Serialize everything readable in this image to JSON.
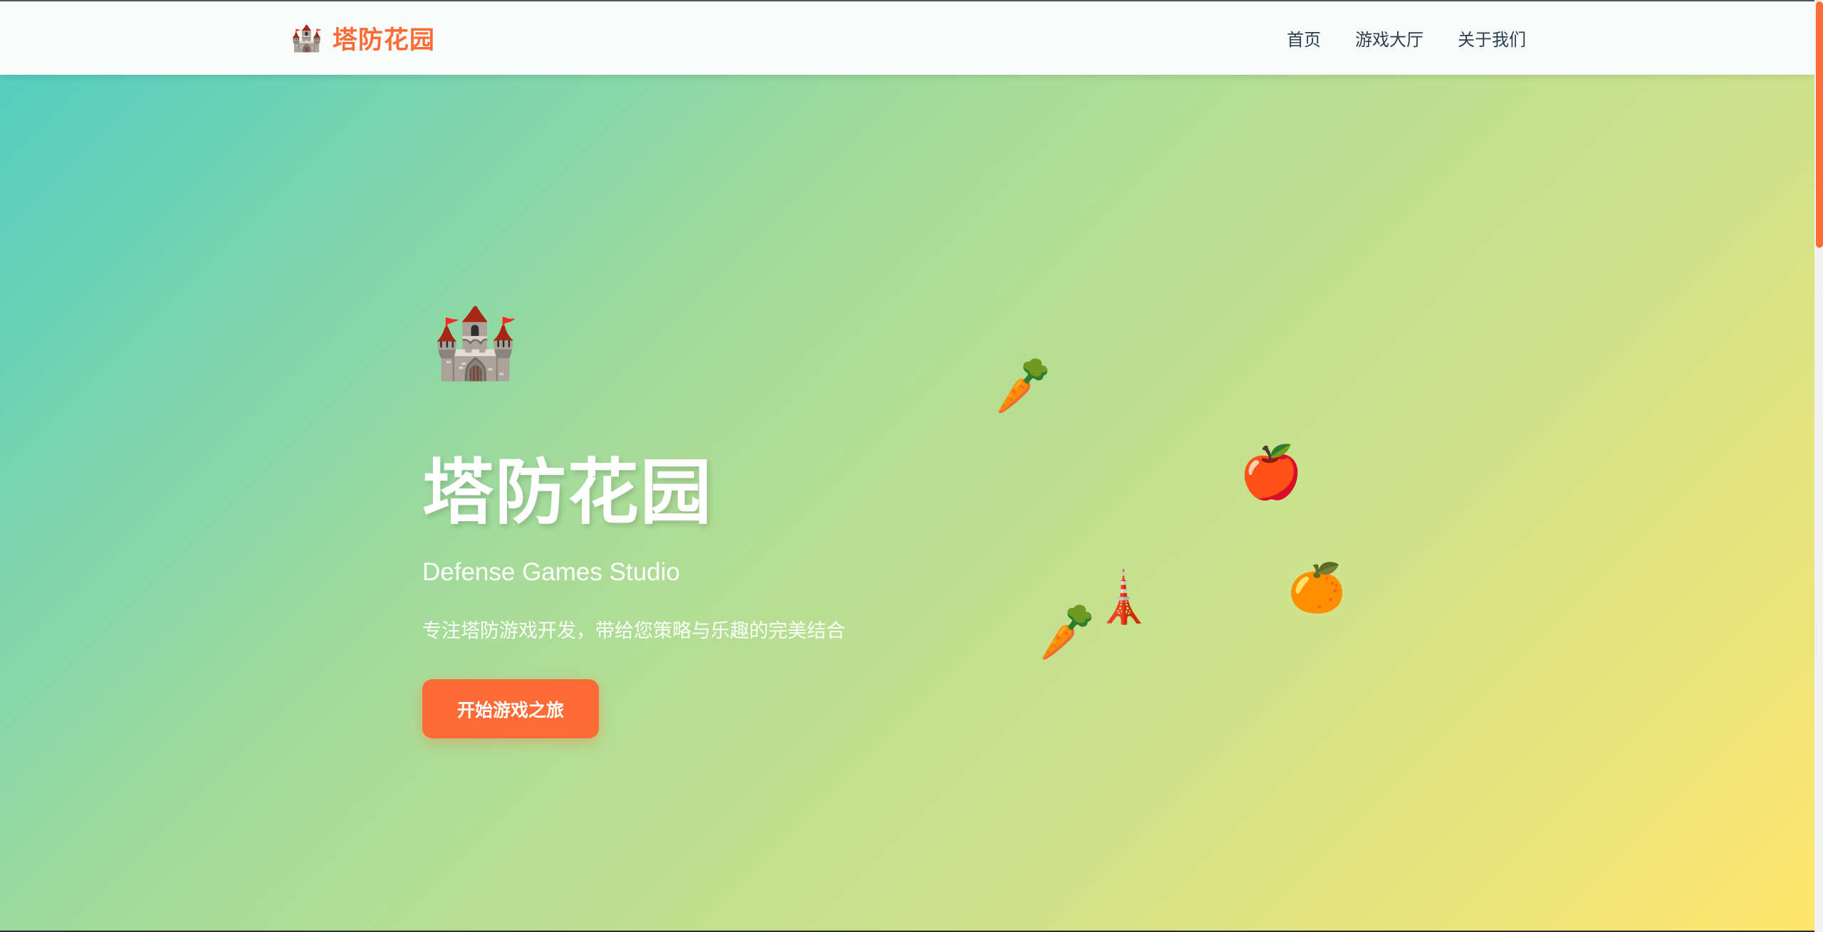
{
  "header": {
    "brand_icon": "castle-icon",
    "brand_icon_glyph": "🏰",
    "brand_title": "塔防花园",
    "nav": [
      {
        "label": "首页"
      },
      {
        "label": "游戏大厅"
      },
      {
        "label": "关于我们"
      }
    ]
  },
  "hero": {
    "castle_glyph": "🏰",
    "title": "塔防花园",
    "subtitle": "Defense Games Studio",
    "description": "专注塔防游戏开发，带给您策略与乐趣的完美结合",
    "cta_label": "开始游戏之旅"
  },
  "decorations": {
    "carrot": "🥕",
    "apple": "🍎",
    "orange": "🍊",
    "tower": "🗼"
  },
  "colors": {
    "accent": "#ff6b35",
    "gradient_start": "#4ecdc4",
    "gradient_end": "#ffe66d",
    "nav_text": "#2c3e50"
  }
}
